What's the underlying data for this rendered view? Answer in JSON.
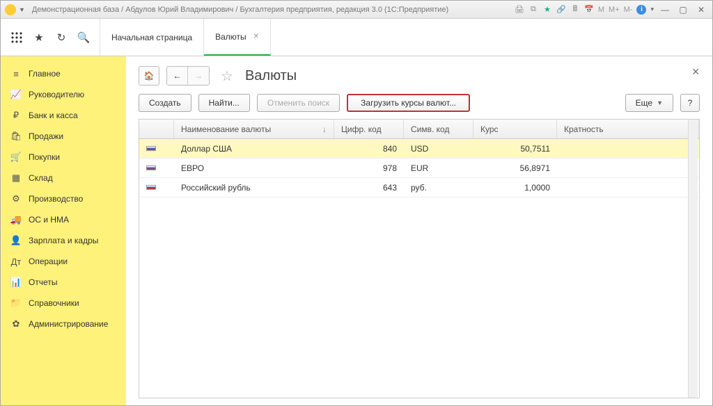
{
  "titlebar": {
    "title": "Демонстрационная база / Абдулов Юрий Владимирович / Бухгалтерия предприятия, редакция 3.0  (1С:Предприятие)",
    "mem": {
      "m": "M",
      "mplus": "M+",
      "mminus": "M-"
    }
  },
  "tabs": {
    "home": "Начальная страница",
    "currencies": "Валюты"
  },
  "sidebar": {
    "items": [
      {
        "label": "Главное",
        "icon": "≡"
      },
      {
        "label": "Руководителю",
        "icon": "📈"
      },
      {
        "label": "Банк и касса",
        "icon": "₽"
      },
      {
        "label": "Продажи",
        "icon": "🛍"
      },
      {
        "label": "Покупки",
        "icon": "🛒"
      },
      {
        "label": "Склад",
        "icon": "▦"
      },
      {
        "label": "Производство",
        "icon": "⚙"
      },
      {
        "label": "ОС и НМА",
        "icon": "🚚"
      },
      {
        "label": "Зарплата и кадры",
        "icon": "👤"
      },
      {
        "label": "Операции",
        "icon": "Дт"
      },
      {
        "label": "Отчеты",
        "icon": "📊"
      },
      {
        "label": "Справочники",
        "icon": "📁"
      },
      {
        "label": "Администрирование",
        "icon": "✿"
      }
    ]
  },
  "page": {
    "title": "Валюты"
  },
  "cmd": {
    "create": "Создать",
    "find": "Найти...",
    "cancel_find": "Отменить поиск",
    "load_rates": "Загрузить курсы валют...",
    "more": "Еще",
    "help": "?"
  },
  "table": {
    "headers": {
      "name": "Наименование валюты",
      "num": "Цифр. код",
      "sym": "Симв. код",
      "rate": "Курс",
      "mult": "Кратность"
    },
    "rows": [
      {
        "name": "Доллар США",
        "num": "840",
        "sym": "USD",
        "rate": "50,7511",
        "mult": "",
        "selected": true
      },
      {
        "name": "ЕВРО",
        "num": "978",
        "sym": "EUR",
        "rate": "56,8971",
        "mult": "",
        "selected": false
      },
      {
        "name": "Российский рубль",
        "num": "643",
        "sym": "руб.",
        "rate": "1,0000",
        "mult": "",
        "selected": false
      }
    ]
  }
}
